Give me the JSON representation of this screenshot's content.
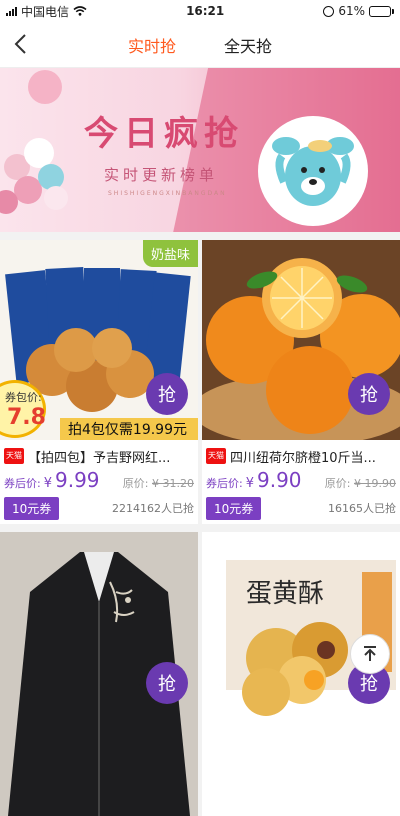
{
  "status": {
    "carrier": "中国电信",
    "time": "16:21",
    "battery": "61%",
    "battery_level": 0.61
  },
  "nav": {
    "tabs": [
      {
        "label": "实时抢",
        "active": true
      },
      {
        "label": "全天抢",
        "active": false
      }
    ]
  },
  "banner": {
    "title": "今日疯抢",
    "subtitle": "实时更新榜单",
    "small": "SHISHIGENGXINBANGDAN"
  },
  "products": [
    {
      "image": "cookies",
      "badge": "奶盐味",
      "price_badge_label": "券包价:",
      "price_badge_value": "7.8",
      "promo": "拍4包仅需19.99元",
      "platform": "天猫",
      "title": "【拍四包】予吉野网红...",
      "after_coupon_label": "券后价:",
      "currency": "¥",
      "price": "9.99",
      "original_label": "原价:",
      "original_price": "¥ 31.20",
      "coupon": "10元券",
      "sold": "2214162人已抢",
      "grab": "抢"
    },
    {
      "image": "oranges",
      "platform": "天猫",
      "title": "四川纽荷尔脐橙10斤当...",
      "after_coupon_label": "券后价:",
      "currency": "¥",
      "price": "9.90",
      "original_label": "原价:",
      "original_price": "¥ 19.90",
      "coupon": "10元券",
      "sold": "16165人已抢",
      "grab": "抢"
    },
    {
      "image": "jacket",
      "grab": "抢"
    },
    {
      "image": "egg-yolk-pastry",
      "grab": "抢"
    }
  ],
  "colors": {
    "accent": "#ff5a1f",
    "purple": "#7b3fc2"
  },
  "icons": [
    "back-arrow-icon",
    "wifi-icon",
    "signal-icon",
    "alarm-icon",
    "battery-icon",
    "back-to-top-icon",
    "tmall-icon"
  ]
}
